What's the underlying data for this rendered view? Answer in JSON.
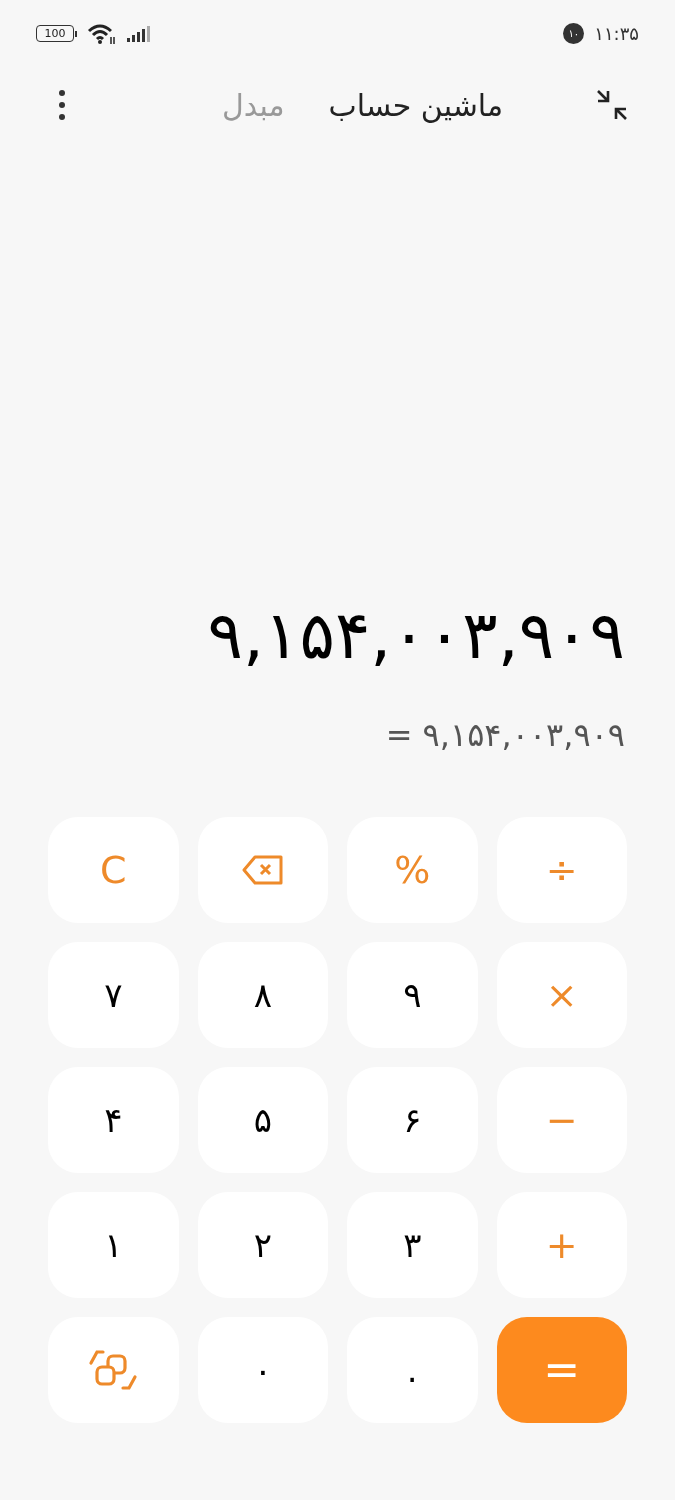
{
  "status_bar": {
    "battery": "100",
    "notification_count": "۱۰",
    "time": "۱۱:۳۵"
  },
  "tabs": [
    {
      "label": "ماشین حساب",
      "selected": true
    },
    {
      "label": "مبدل",
      "selected": false
    }
  ],
  "display": {
    "expression": "۹,۱۵۴,۰۰۳,۹۰۹",
    "result": "= ۹,۱۵۴,۰۰۳,۹۰۹"
  },
  "keypad_rows": [
    {
      "keys": [
        {
          "kind": "operator",
          "label": "÷"
        },
        {
          "kind": "operator",
          "label": "%"
        },
        {
          "kind": "backspace"
        },
        {
          "kind": "operator",
          "label": "C"
        }
      ]
    },
    {
      "keys": [
        {
          "kind": "operator",
          "label": "×"
        },
        {
          "kind": "digit",
          "label": "۹"
        },
        {
          "kind": "digit",
          "label": "۸"
        },
        {
          "kind": "digit",
          "label": "۷"
        }
      ]
    },
    {
      "keys": [
        {
          "kind": "operator",
          "label": "−"
        },
        {
          "kind": "digit",
          "label": "۶"
        },
        {
          "kind": "digit",
          "label": "۵"
        },
        {
          "kind": "digit",
          "label": "۴"
        }
      ]
    },
    {
      "keys": [
        {
          "kind": "operator",
          "label": "+"
        },
        {
          "kind": "digit",
          "label": "۳"
        },
        {
          "kind": "digit",
          "label": "۲"
        },
        {
          "kind": "digit",
          "label": "۱"
        }
      ]
    },
    {
      "keys": [
        {
          "kind": "equals",
          "label": "="
        },
        {
          "kind": "digit",
          "label": "."
        },
        {
          "kind": "digit",
          "label": "۰"
        },
        {
          "kind": "convert"
        }
      ]
    }
  ]
}
